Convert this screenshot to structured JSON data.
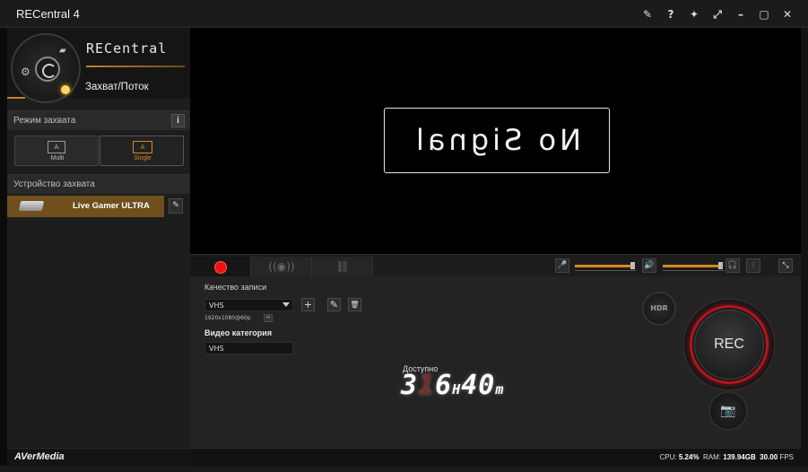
{
  "window": {
    "title": "RECentral 4"
  },
  "titlebar": {
    "controls": [
      "wand-icon",
      "help-icon",
      "pin-icon",
      "expand-icon",
      "minimize-icon",
      "maximize-icon",
      "close-icon"
    ],
    "glyphs": {
      "wand": "✎",
      "help": "?",
      "pin": "✦",
      "expand": "⤢",
      "minimize": "–",
      "maximize": "▢",
      "close": "✕"
    }
  },
  "brand": {
    "name": "RECentral",
    "mode": "Захват/Поток"
  },
  "sidebar": {
    "capture_mode_label": "Режим захвата",
    "info": "i",
    "modes": [
      {
        "label": "Multi",
        "icon": "A",
        "active": false
      },
      {
        "label": "Single",
        "icon": "A",
        "active": true
      }
    ],
    "device_label": "Устройство захвата",
    "device_name": "Live Gamer ULTRA",
    "edit": "✎"
  },
  "preview": {
    "message": "No Signal"
  },
  "footer": {
    "logo": "AVerMedia"
  },
  "controls": {
    "tabs": [
      {
        "name": "record",
        "active": true
      },
      {
        "name": "stream",
        "glyph": "((◉))",
        "active": false
      },
      {
        "name": "network",
        "glyph": "⛓",
        "active": false
      }
    ],
    "mic_level": 0.95,
    "speaker_level": 0.95
  },
  "recording": {
    "quality_label": "Качество записи",
    "quality_value": "VHS",
    "resolution": "1920x1080@60p",
    "res_btn": "↔",
    "category_label": "Видео категория",
    "category_value": "VHS",
    "add": "+",
    "edit": "✎",
    "delete": "🗑",
    "available_label": "Доступно",
    "timer_value": "3",
    "timer_ghost": "1",
    "timer_rest": "6",
    "timer_h": "H",
    "timer_m_value": "40",
    "timer_m": "m",
    "hdr": "HDR",
    "rec": "REC",
    "camera": "📷"
  },
  "status": {
    "cpu_label": "CPU:",
    "cpu_value": "5.24%",
    "ram_label": "RAM:",
    "ram_value": "139.94GB",
    "fps_value": "30.00",
    "fps_label": "FPS"
  },
  "colors": {
    "accent": "#d8881a",
    "rec_red": "#e11111"
  }
}
